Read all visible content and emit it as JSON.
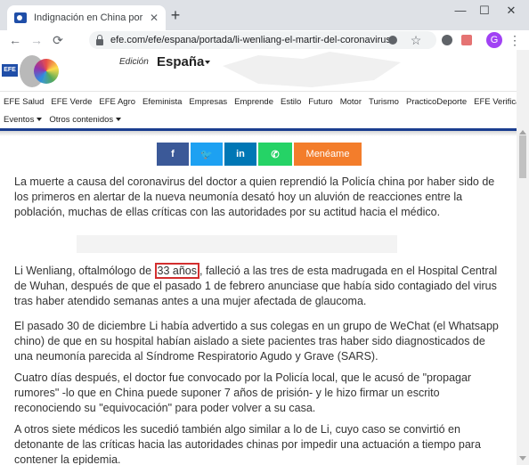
{
  "browser": {
    "tab_title": "Indignación en China por la mue",
    "tab_close": "✕",
    "new_tab": "+",
    "minimize": "—",
    "maximize": "☐",
    "close": "✕",
    "back": "←",
    "forward": "→",
    "reload": "⟳",
    "url": "efe.com/efe/espana/portada/li-wenliang-el-martir-del-coronavirus...",
    "star": "☆",
    "avatar": "G",
    "menu": "⋮",
    "icons": [
      "back-icon",
      "forward-icon",
      "reload-icon",
      "lock-icon",
      "star-icon",
      "extension-icon",
      "menu-icon"
    ]
  },
  "site": {
    "logo": "EFE",
    "edicion_label": "Edición",
    "edicion_value": "España",
    "nav_row1": [
      "EFE Salud",
      "EFE Verde",
      "EFE Agro",
      "Efeminista",
      "Empresas",
      "Emprende",
      "Estilo",
      "Futuro",
      "Motor",
      "Turismo",
      "PracticoDeporte",
      "EFE Verifica"
    ],
    "nav_row2": [
      "Eventos",
      "Otros contenidos"
    ]
  },
  "share": {
    "facebook": "f",
    "twitter": "🐦",
    "linkedin": "in",
    "whatsapp": "✆",
    "meneame": "Menéame"
  },
  "article": {
    "p1": "La muerte a causa del coronavirus del doctor a quien reprendió la Policía china por haber sido de los primeros en alertar de la nueva neumonía desató hoy un aluvión de reacciones entre la población, muchas de ellas críticas con las autoridades por su actitud hacia el médico.",
    "p2_before": "Li Wenliang, oftalmólogo de ",
    "p2_highlight": "33 años",
    "p2_after": ", falleció a las tres de esta madrugada en el Hospital Central de Wuhan, después de que el pasado 1 de febrero anunciase que había sido contagiado del virus tras haber atendido semanas antes a una mujer afectada de glaucoma.",
    "p3": "El pasado 30 de diciembre Li había advertido a sus colegas en un grupo de WeChat (el Whatsapp chino) de que en su hospital habían aislado a siete pacientes tras haber sido diagnosticados de una neumonía parecida al Síndrome Respiratorio Agudo y Grave (SARS).",
    "p4": "Cuatro días después, el doctor fue convocado por la Policía local, que le acusó de \"propagar rumores\" -lo que en China puede suponer 7 años de prisión- y le hizo firmar un escrito reconociendo su \"equivocación\" para poder volver a su casa.",
    "p5": "A otros siete médicos les sucedió también algo similar a lo de Li, cuyo caso se convirtió en detonante de las críticas hacia las autoridades chinas por impedir una actuación a tiempo para contener la epidemia."
  }
}
